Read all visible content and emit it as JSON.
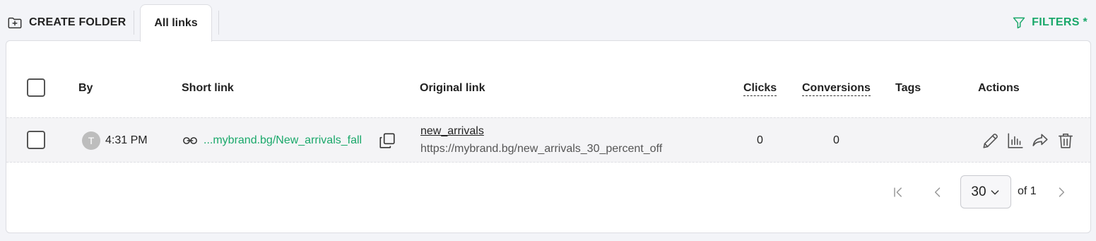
{
  "toolbar": {
    "create_folder_label": "CREATE FOLDER",
    "tab_label": "All links",
    "filters_label": "FILTERS *"
  },
  "table": {
    "headers": {
      "by": "By",
      "short_link": "Short link",
      "original_link": "Original link",
      "clicks": "Clicks",
      "conversions": "Conversions",
      "tags": "Tags",
      "actions": "Actions"
    },
    "rows": [
      {
        "avatar_initial": "T",
        "time": "4:31 PM",
        "short_link": "...mybrand.bg/New_arrivals_fall",
        "original_title": "new_arrivals",
        "original_url": "https://mybrand.bg/new_arrivals_30_percent_off",
        "clicks": "0",
        "conversions": "0",
        "actions": [
          "pencil-icon",
          "bar-chart-icon",
          "share-icon",
          "trash-icon"
        ]
      }
    ]
  },
  "pagination": {
    "per_page": "30",
    "of_label": "of 1"
  },
  "colors": {
    "accent": "#1aa86a",
    "background": "#f3f4f8",
    "row_background": "#f4f4f6"
  }
}
